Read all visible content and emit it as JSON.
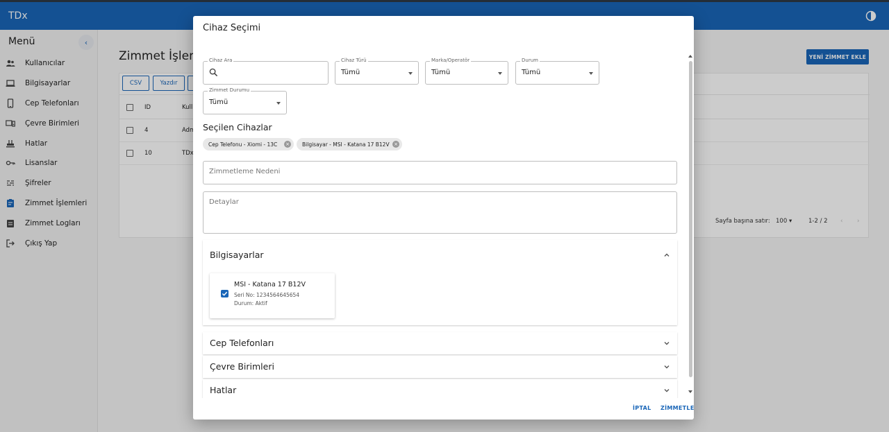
{
  "app": {
    "brand": "TDx"
  },
  "sidebar": {
    "title": "Menü",
    "items": [
      {
        "label": "Kullanıcılar",
        "icon": "users-icon"
      },
      {
        "label": "Bilgisayarlar",
        "icon": "laptop-icon"
      },
      {
        "label": "Cep Telefonları",
        "icon": "phone-icon"
      },
      {
        "label": "Çevre Birimleri",
        "icon": "peripherals-icon"
      },
      {
        "label": "Hatlar",
        "icon": "sim-line-icon"
      },
      {
        "label": "Lisanslar",
        "icon": "key-icon"
      },
      {
        "label": "Şifreler",
        "icon": "password-icon"
      },
      {
        "label": "Zimmet İşlemleri",
        "icon": "assignment-icon",
        "active": true
      },
      {
        "label": "Zimmet Logları",
        "icon": "log-icon"
      },
      {
        "label": "Çıkış Yap",
        "icon": "logout-icon"
      }
    ]
  },
  "page": {
    "title": "Zimmet İşlemle",
    "new_button": "YENİ ZİMMET EKLE",
    "toolbar": {
      "csv": "CSV",
      "print": "Yazdır"
    },
    "table": {
      "headers": [
        "ID",
        "Kull"
      ],
      "rows": [
        [
          "4",
          "Adm"
        ],
        [
          "10",
          "TDx"
        ]
      ]
    },
    "pager": {
      "rows_label": "Sayfa başına satır:",
      "rows_value": "100",
      "range": "1-2 / 2"
    }
  },
  "dialog": {
    "title": "Cihaz Seçimi",
    "filters": {
      "search": {
        "label": "Cihaz Ara",
        "value": ""
      },
      "type": {
        "label": "Cihaz Türü",
        "value": "Tümü"
      },
      "brand": {
        "label": "Marka/Operatör",
        "value": "Tümü"
      },
      "status": {
        "label": "Durum",
        "value": "Tümü"
      },
      "assign_status": {
        "label": "Zimmet Durumu",
        "value": "Tümü"
      }
    },
    "selected_title": "Seçilen Cihazlar",
    "chips": [
      "Cep Telefonu - Xiomi - 13C",
      "Bilgisayar - MSI - Katana 17 B12V"
    ],
    "reason_placeholder": "Zimmetleme Nedeni",
    "details_placeholder": "Detaylar",
    "sections": {
      "computers": {
        "title": "Bilgisayarlar",
        "device": {
          "name": "MSI - Katana 17 B12V",
          "serial": "Seri No: 1234564645654",
          "status": "Durum: Aktif"
        }
      },
      "phones": {
        "title": "Cep Telefonları"
      },
      "peripherals": {
        "title": "Çevre Birimleri"
      },
      "lines": {
        "title": "Hatlar"
      }
    },
    "cancel": "İPTAL",
    "confirm": "ZİMMETLE"
  }
}
